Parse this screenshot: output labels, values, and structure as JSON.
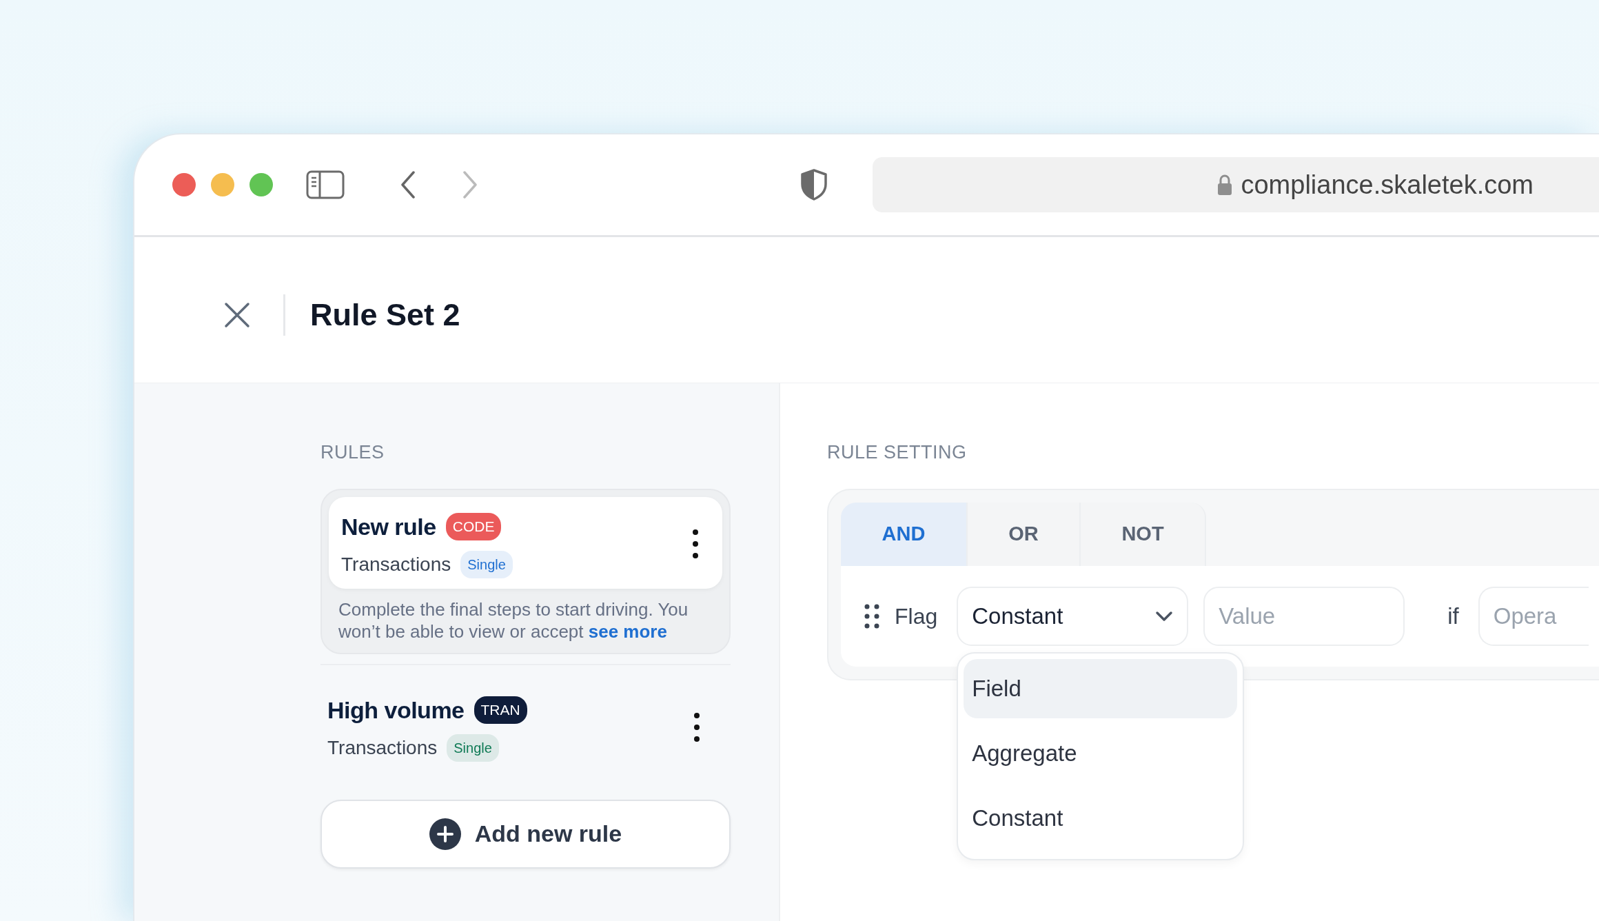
{
  "browser": {
    "url": "compliance.skaletek.com"
  },
  "header": {
    "title": "Rule Set 2"
  },
  "rules_panel": {
    "heading": "RULES",
    "rules": [
      {
        "title": "New rule",
        "tag": {
          "text": "CODE",
          "color": "#eb5a5a"
        },
        "source": "Transactions",
        "mode": {
          "text": "Single",
          "color": "#1f6fd1"
        },
        "selected": true,
        "note": "Complete the final steps to start driving. You won’t be able to view or accept",
        "link": "see more"
      },
      {
        "title": "High volume",
        "tag": {
          "text": "TRAN",
          "color": "#0f1d3a"
        },
        "source": "Transactions",
        "mode": {
          "text": "Single",
          "color": "#0f7a55"
        },
        "selected": false
      }
    ],
    "add_button": "Add new rule"
  },
  "setting_panel": {
    "heading": "RULE SETTING",
    "operators": [
      {
        "label": "AND",
        "selected": true
      },
      {
        "label": "OR",
        "selected": false
      },
      {
        "label": "NOT",
        "selected": false
      }
    ],
    "condition": {
      "label": "Flag",
      "type_select": {
        "value": "Constant",
        "expanded": true,
        "options": [
          {
            "label": "Field",
            "highlighted": true
          },
          {
            "label": "Aggregate",
            "highlighted": false
          },
          {
            "label": "Constant",
            "highlighted": false
          }
        ]
      },
      "value": {
        "placeholder": "Value"
      },
      "keyword": "if",
      "operator": {
        "placeholder": "Opera"
      }
    }
  }
}
